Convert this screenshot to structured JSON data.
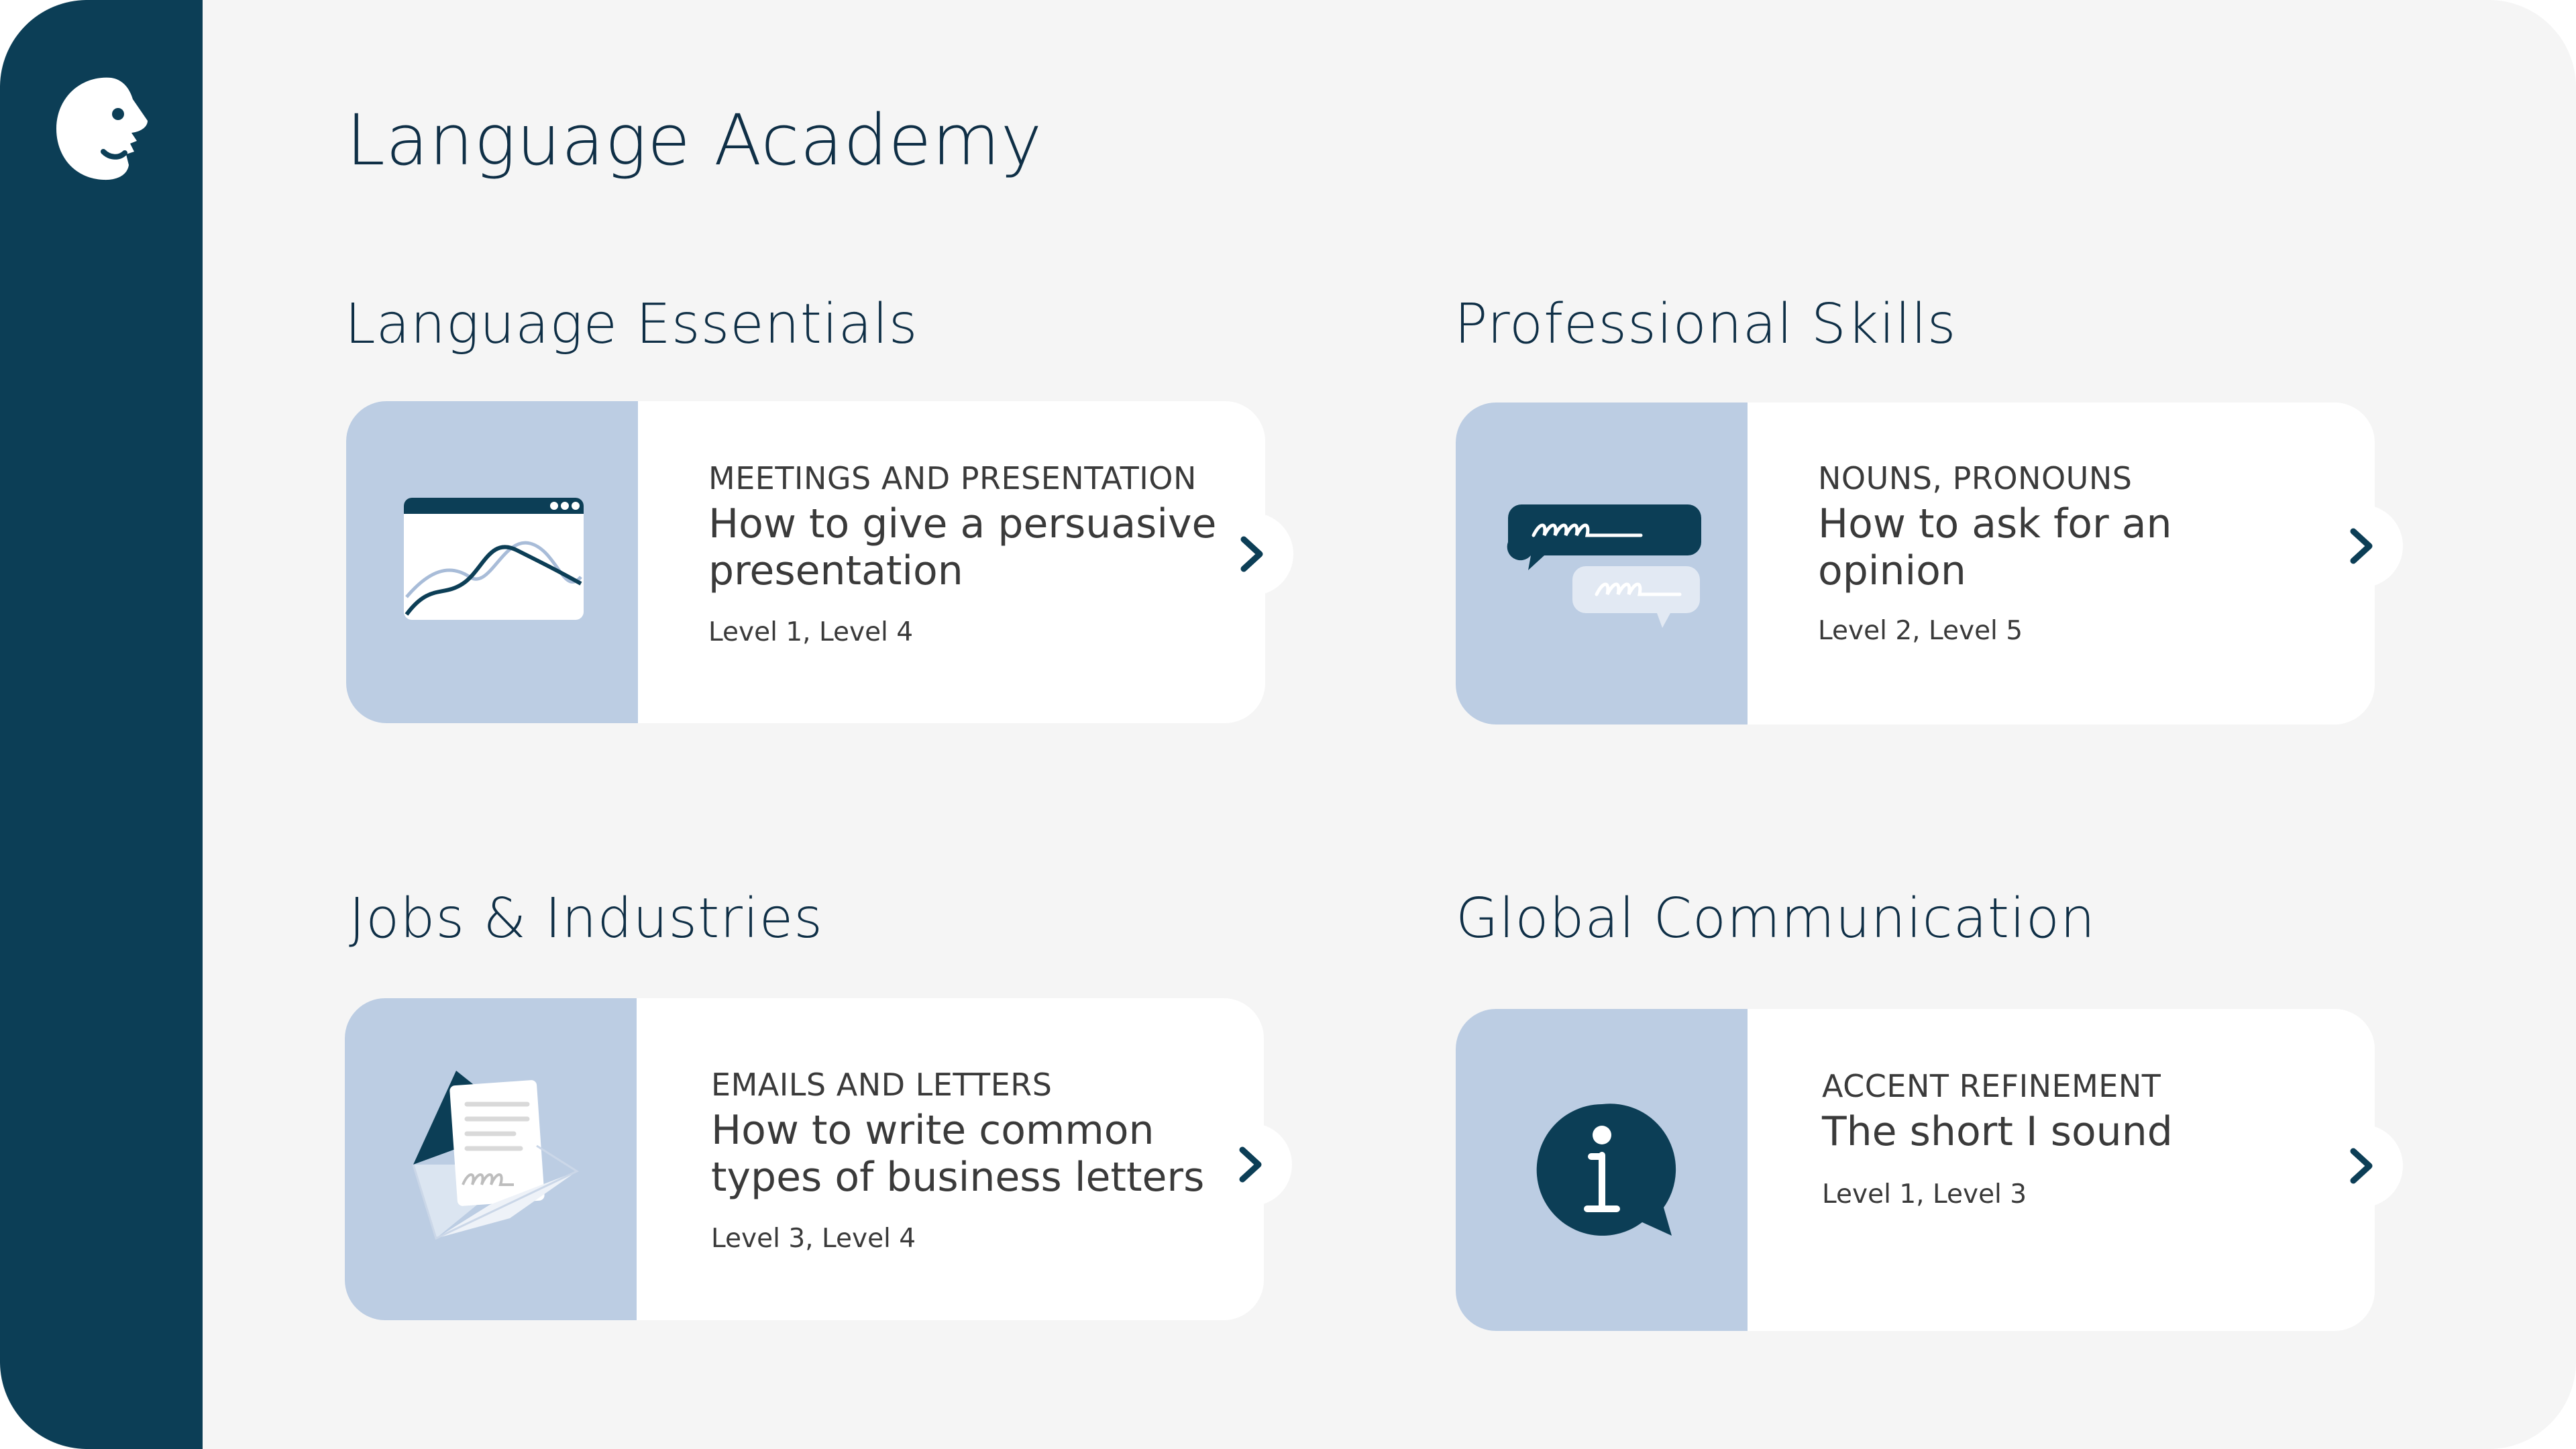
{
  "app": {
    "title": "Language Academy",
    "logo_icon": "face-profile-icon"
  },
  "sections": [
    {
      "title": "Language Essentials",
      "card": {
        "category": "MEETINGS AND PRESENTATION",
        "heading": "How to give a persuasive presentation",
        "levels": "Level 1, Level 4",
        "icon": "presentation-chart-icon"
      }
    },
    {
      "title": "Professional Skills",
      "card": {
        "category": "NOUNS, PRONOUNS",
        "heading": "How to ask for an opinion",
        "levels": "Level 2, Level 5",
        "icon": "chat-bubbles-icon"
      }
    },
    {
      "title": "Jobs & Industries",
      "card": {
        "category": "EMAILS AND LETTERS",
        "heading": "How to write common types of business letters",
        "levels": "Level 3, Level 4",
        "icon": "envelope-letter-icon"
      }
    },
    {
      "title": "Global Communication",
      "card": {
        "category": "ACCENT REFINEMENT",
        "heading": "The short I sound",
        "levels": "Level 1, Level 3",
        "icon": "info-bubble-icon"
      }
    }
  ],
  "colors": {
    "sidebar": "#0c3e56",
    "background": "#f5f5f5",
    "thumbnail": "#bccde3",
    "heading_text": "#0f2f46",
    "body_text": "#3a3a3a"
  }
}
